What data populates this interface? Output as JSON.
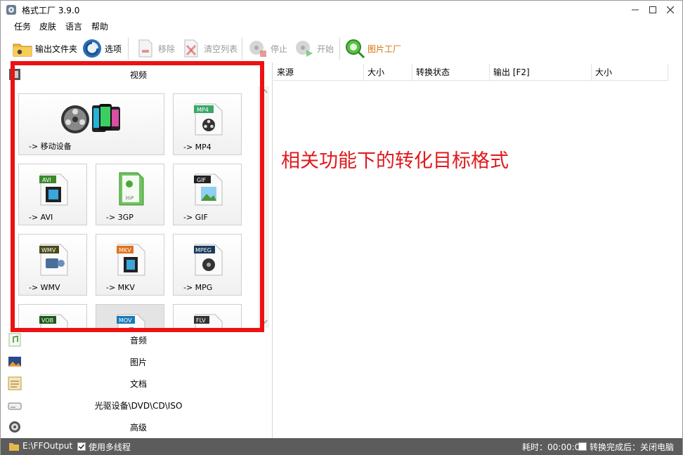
{
  "window": {
    "title": "格式工厂 3.9.0"
  },
  "menu": [
    "任务",
    "皮肤",
    "语言",
    "帮助"
  ],
  "toolbar": {
    "output_folder": "输出文件夹",
    "options": "选项",
    "remove": "移除",
    "clear_list": "清空列表",
    "stop": "停止",
    "start": "开始",
    "picture_factory": "图片工厂"
  },
  "left_panel": {
    "categories": {
      "video": "视频",
      "audio": "音频",
      "picture": "图片",
      "document": "文档",
      "disc": "光驱设备\\DVD\\CD\\ISO",
      "advanced": "高级"
    },
    "tiles": [
      {
        "label": "-> 移动设备"
      },
      {
        "label": "-> MP4",
        "badge": "MP4"
      },
      {
        "label": "-> AVI",
        "badge": "AVI"
      },
      {
        "label": "-> 3GP",
        "badge": "3GP"
      },
      {
        "label": "-> GIF",
        "badge": "GIF"
      },
      {
        "label": "-> WMV",
        "badge": "WMV"
      },
      {
        "label": "-> MKV",
        "badge": "MKV"
      },
      {
        "label": "-> MPG",
        "badge": "MPEG"
      },
      {
        "badge": "VOB"
      },
      {
        "badge": "MOV"
      },
      {
        "badge": "FLV"
      }
    ]
  },
  "task_list": {
    "columns": [
      "来源",
      "大小",
      "转换状态",
      "输出 [F2]",
      "大小"
    ]
  },
  "annotation": "相关功能下的转化目标格式",
  "statusbar": {
    "output_path": "E:\\FFOutput",
    "multithread": "使用多线程",
    "elapsed": "耗时：00:00:00",
    "after_convert": "转换完成后：关闭电脑"
  },
  "colors": {
    "annotation": "#e0191d",
    "statusbar": "#5c5c5c",
    "highlight": "#ee1111"
  }
}
